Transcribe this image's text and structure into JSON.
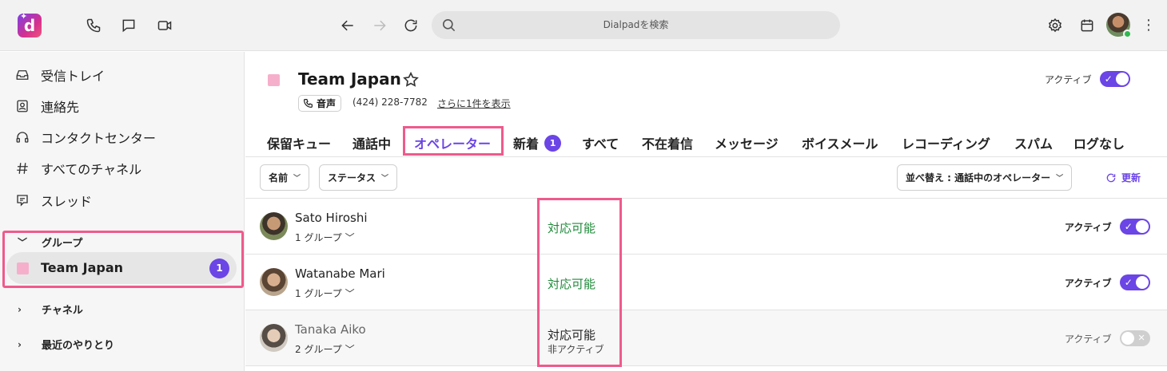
{
  "topbar": {
    "logo_letter": "d",
    "search_placeholder": "Dialpadを検索",
    "icons": [
      "phone-icon",
      "chat-icon",
      "video-icon",
      "back-icon",
      "forward-icon",
      "refresh-icon",
      "search-icon",
      "gear-icon",
      "calendar-icon",
      "kebab-icon"
    ]
  },
  "sidebar": {
    "items": [
      {
        "label": "受信トレイ",
        "icon": "inbox-icon"
      },
      {
        "label": "連絡先",
        "icon": "contacts-icon"
      },
      {
        "label": "コンタクトセンター",
        "icon": "headset-icon"
      },
      {
        "label": "すべてのチャネル",
        "icon": "hash-icon"
      },
      {
        "label": "スレッド",
        "icon": "thread-icon"
      }
    ],
    "groups_label": "グループ",
    "team": {
      "label": "Team Japan",
      "badge": "1",
      "color": "#f6afcb"
    },
    "channels_label": "チャネル",
    "recent_label": "最近のやりとり"
  },
  "header": {
    "title": "Team Japan",
    "active_label": "アクティブ",
    "voice_label": "音声",
    "phone": "(424) 228-7782",
    "more_link": "さらに1件を表示"
  },
  "tabs": [
    {
      "label": "保留キュー"
    },
    {
      "label": "通話中"
    },
    {
      "label": "オペレーター"
    },
    {
      "label": "新着",
      "badge": "1"
    },
    {
      "label": "すべて"
    },
    {
      "label": "不在着信"
    },
    {
      "label": "メッセージ"
    },
    {
      "label": "ボイスメール"
    },
    {
      "label": "レコーディング"
    },
    {
      "label": "スパム"
    },
    {
      "label": "ログなし"
    }
  ],
  "filters": {
    "name": "名前",
    "status": "ステータス",
    "sort": "並べ替え : 通話中のオペレーター",
    "refresh": "更新"
  },
  "operators": [
    {
      "name": "Sato Hiroshi",
      "groups": "1 グループ",
      "status": "対応可能",
      "sub": "",
      "active_label": "アクティブ",
      "active": true
    },
    {
      "name": "Watanabe Mari",
      "groups": "1 グループ",
      "status": "対応可能",
      "sub": "",
      "active_label": "アクティブ",
      "active": true
    },
    {
      "name": "Tanaka Aiko",
      "groups": "2 グループ",
      "status": "対応可能",
      "sub": "非アクティブ",
      "active_label": "アクティブ",
      "active": false
    }
  ],
  "colors": {
    "accent": "#6b45e5",
    "available": "#1f8a3a",
    "highlight": "#ef5a8c"
  }
}
